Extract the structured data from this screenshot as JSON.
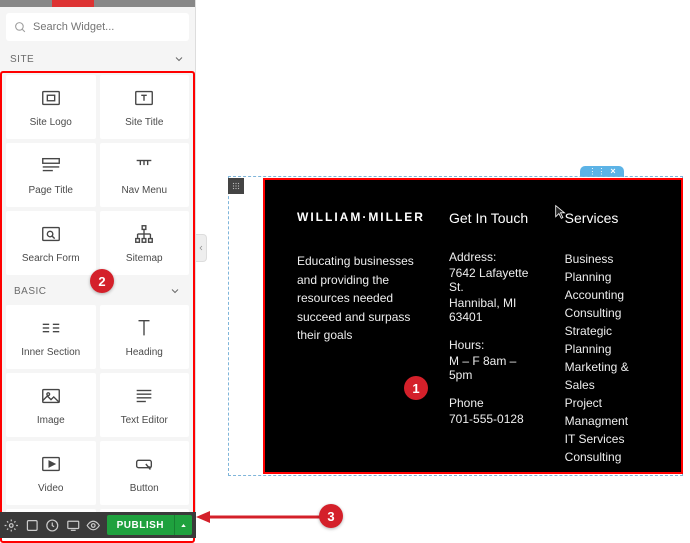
{
  "search": {
    "placeholder": "Search Widget..."
  },
  "sections": {
    "site": "SITE",
    "basic": "BASIC"
  },
  "widgets": {
    "site": [
      {
        "key": "site-logo",
        "label": "Site Logo"
      },
      {
        "key": "site-title",
        "label": "Site Title"
      },
      {
        "key": "page-title",
        "label": "Page Title"
      },
      {
        "key": "nav-menu",
        "label": "Nav Menu"
      },
      {
        "key": "search-form",
        "label": "Search Form"
      },
      {
        "key": "sitemap",
        "label": "Sitemap"
      }
    ],
    "basic": [
      {
        "key": "inner-section",
        "label": "Inner Section"
      },
      {
        "key": "heading",
        "label": "Heading"
      },
      {
        "key": "image",
        "label": "Image"
      },
      {
        "key": "text-editor",
        "label": "Text Editor"
      },
      {
        "key": "video",
        "label": "Video"
      },
      {
        "key": "button",
        "label": "Button"
      },
      {
        "key": "divider",
        "label": ""
      },
      {
        "key": "spacer",
        "label": ""
      }
    ]
  },
  "publish": {
    "label": "PUBLISH"
  },
  "footer": {
    "brand": "WILLIAM·MILLER",
    "tagline": "Educating businesses and providing the resources needed succeed and surpass their goals",
    "contact_heading": "Get In Touch",
    "address_label": "Address:",
    "address_line1": "7642 Lafayette St.",
    "address_line2": "Hannibal, MI 63401",
    "hours_label": "Hours:",
    "hours_value": "M – F 8am – 5pm",
    "phone_label": "Phone",
    "phone_value": "701-555-0128",
    "services_heading": "Services",
    "services": [
      "Business Planning",
      "Accounting",
      "Consulting",
      "Strategic Planning",
      "Marketing & Sales",
      "Project Managment",
      "IT Services",
      "Consulting"
    ]
  },
  "markers": {
    "m1": "1",
    "m2": "2",
    "m3": "3"
  }
}
